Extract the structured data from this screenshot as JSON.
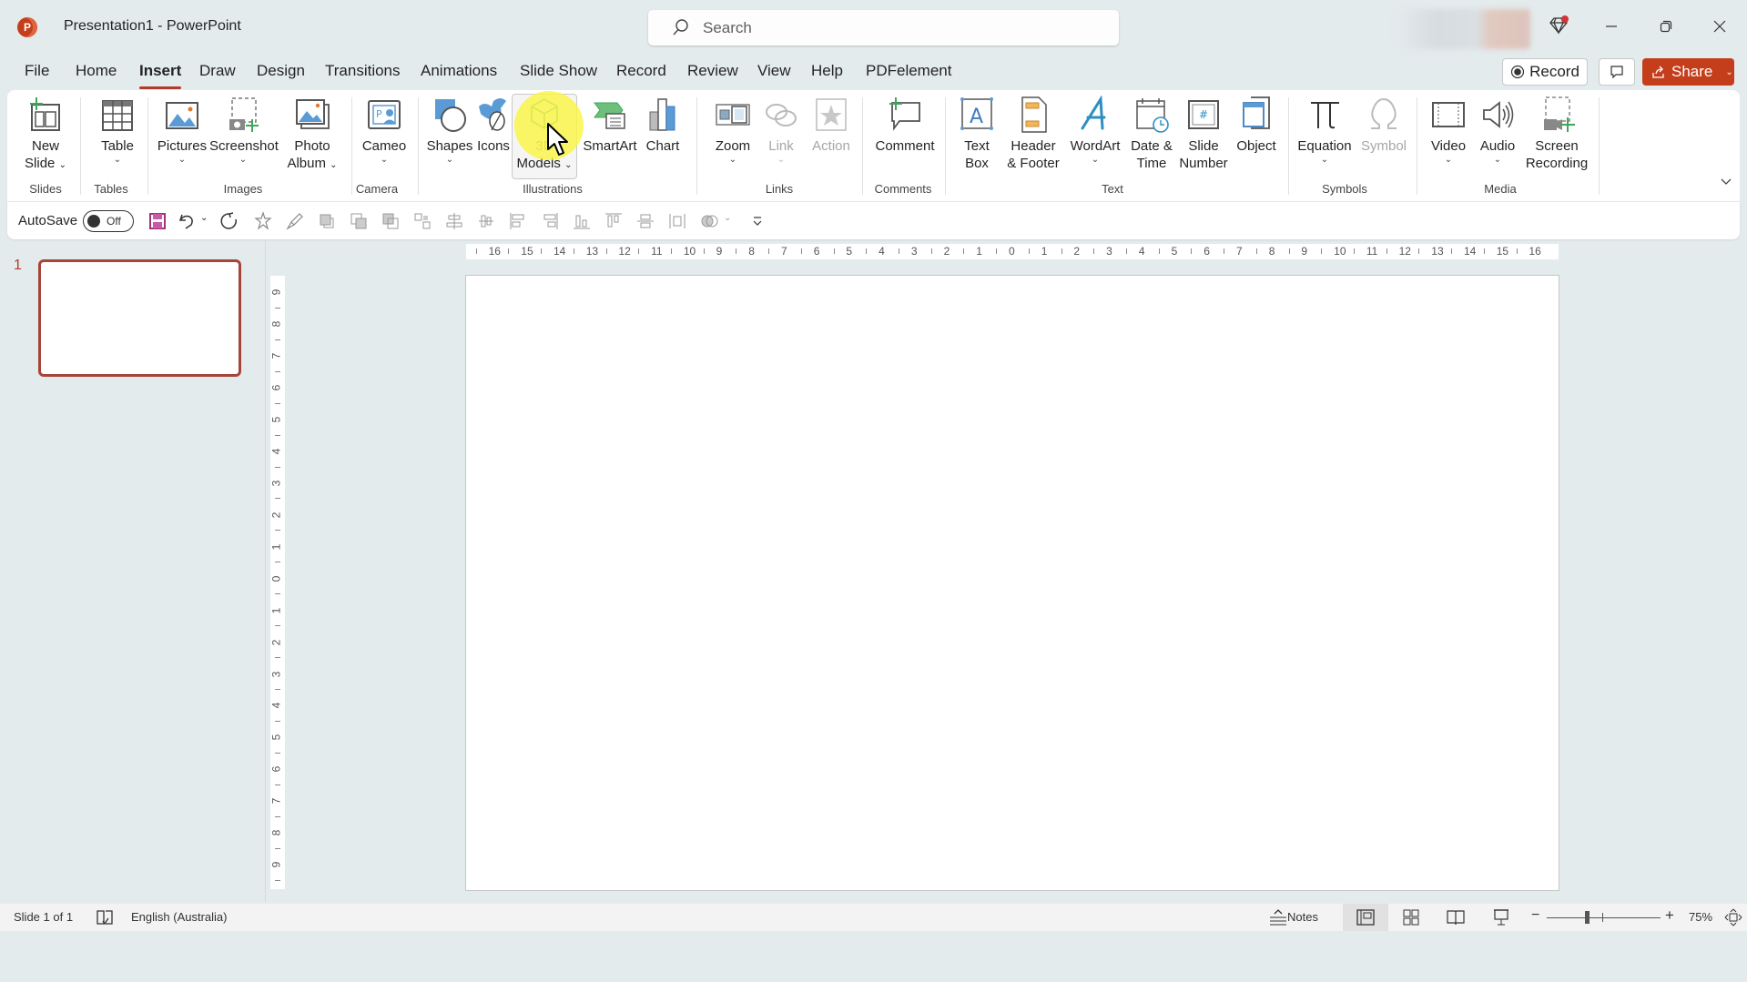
{
  "window": {
    "title": "Presentation1  -  PowerPoint",
    "app_icon": "powerpoint-logo-icon",
    "search_placeholder": "Search",
    "controls": [
      "minimize-icon",
      "restore-icon",
      "close-icon"
    ]
  },
  "tabs": [
    {
      "label": "File",
      "active": false
    },
    {
      "label": "Home",
      "active": false
    },
    {
      "label": "Insert",
      "active": true
    },
    {
      "label": "Draw",
      "active": false
    },
    {
      "label": "Design",
      "active": false
    },
    {
      "label": "Transitions",
      "active": false
    },
    {
      "label": "Animations",
      "active": false
    },
    {
      "label": "Slide Show",
      "active": false
    },
    {
      "label": "Record",
      "active": false
    },
    {
      "label": "Review",
      "active": false
    },
    {
      "label": "View",
      "active": false
    },
    {
      "label": "Help",
      "active": false
    },
    {
      "label": "PDFelement",
      "active": false
    }
  ],
  "header_buttons": {
    "record": "Record",
    "share": "Share"
  },
  "ribbon": {
    "groups": [
      {
        "label": "Slides"
      },
      {
        "label": "Tables"
      },
      {
        "label": "Images"
      },
      {
        "label": "Camera"
      },
      {
        "label": "Illustrations"
      },
      {
        "label": "Links"
      },
      {
        "label": "Comments"
      },
      {
        "label": "Text"
      },
      {
        "label": "Symbols"
      },
      {
        "label": "Media"
      }
    ],
    "buttons": {
      "new_slide": [
        "New",
        "Slide"
      ],
      "table": "Table",
      "pictures": "Pictures",
      "screenshot": "Screenshot",
      "photo_album": [
        "Photo",
        "Album"
      ],
      "cameo": "Cameo",
      "shapes": "Shapes",
      "icons": "Icons",
      "models_3d": [
        "3D",
        "Models"
      ],
      "smartart": "SmartArt",
      "chart": "Chart",
      "zoom": "Zoom",
      "link": "Link",
      "action": "Action",
      "comment": "Comment",
      "text_box": [
        "Text",
        "Box"
      ],
      "header_footer": [
        "Header",
        "& Footer"
      ],
      "wordart": "WordArt",
      "date_time": [
        "Date &",
        "Time"
      ],
      "slide_number": [
        "Slide",
        "Number"
      ],
      "object": "Object",
      "equation": "Equation",
      "symbol": "Symbol",
      "video": "Video",
      "audio": "Audio",
      "screen_recording": [
        "Screen",
        "Recording"
      ]
    },
    "disabled": [
      "Link",
      "Action",
      "Symbol"
    ],
    "hovered": "3D Models"
  },
  "quick_access": {
    "autosave_label": "AutoSave",
    "autosave_state": "Off",
    "tools": [
      "save-icon",
      "undo-icon",
      "redo-icon",
      "animation-star-icon",
      "format-painter-icon",
      "bring-forward-icon",
      "send-backward-icon",
      "bring-to-front-icon",
      "group-icon",
      "align-center-icon",
      "distribute-horizontal-icon",
      "align-left-icon",
      "align-right-icon",
      "align-bottom-icon",
      "align-top-icon",
      "align-middle-icon",
      "distribute-vertical-icon",
      "merge-shapes-icon",
      "customize-qat-icon"
    ]
  },
  "thumbnails": [
    {
      "number": "1",
      "selected": true
    }
  ],
  "rulers": {
    "horizontal": [
      "16",
      "15",
      "14",
      "13",
      "12",
      "11",
      "10",
      "9",
      "8",
      "7",
      "6",
      "5",
      "4",
      "3",
      "2",
      "1",
      "0",
      "1",
      "2",
      "3",
      "4",
      "5",
      "6",
      "7",
      "8",
      "9",
      "10",
      "11",
      "12",
      "13",
      "14",
      "15",
      "16"
    ],
    "vertical": [
      "9",
      "8",
      "7",
      "6",
      "5",
      "4",
      "3",
      "2",
      "1",
      "0",
      "1",
      "2",
      "3",
      "4",
      "5",
      "6",
      "7",
      "8",
      "9"
    ]
  },
  "status": {
    "slide_indicator": "Slide 1 of 1",
    "language": "English (Australia)",
    "notes": "Notes",
    "zoom_level": "75%",
    "zoom_percent": 75
  },
  "colors": {
    "accent": "#c43e1c",
    "tab_underline": "#b23b2a",
    "thumbnail_border": "#a8453a",
    "background": "#e4ebed"
  }
}
